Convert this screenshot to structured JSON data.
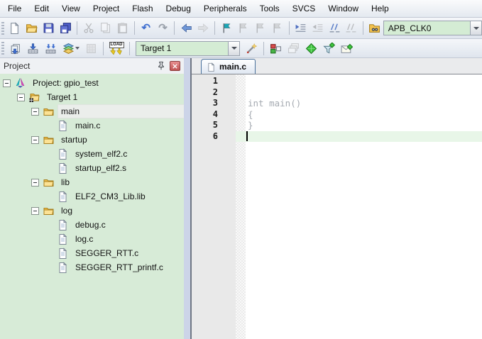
{
  "menu": {
    "items": [
      "File",
      "Edit",
      "View",
      "Project",
      "Flash",
      "Debug",
      "Peripherals",
      "Tools",
      "SVCS",
      "Window",
      "Help"
    ]
  },
  "toolbar_top": {
    "buttons": [
      "new-file",
      "open-file",
      "save",
      "save-all",
      "cut",
      "copy",
      "paste",
      "undo",
      "redo",
      "navigate-back",
      "navigate-forward",
      "toggle-bookmark",
      "previous-bookmark",
      "next-bookmark",
      "clear-bookmarks",
      "indent",
      "outdent",
      "comment",
      "uncomment",
      "find-in-files"
    ],
    "combo_value": "APB_CLK0"
  },
  "toolbar_build": {
    "buttons": [
      "translate",
      "build",
      "rebuild-all",
      "batch-build",
      "stop-build",
      "load-flash",
      "options-for-target",
      "manage-project-items",
      "multi-project-workspace",
      "manage-rte",
      "file-extensions-filter",
      "pack-installer"
    ],
    "load_label": "LOAD",
    "target_value": "Target 1"
  },
  "project_panel": {
    "title": "Project",
    "tree": {
      "items": [
        {
          "label": "Project: gpio_test",
          "level": 0,
          "icon": "uvision-project",
          "expanded": true
        },
        {
          "label": "Target 1",
          "level": 1,
          "icon": "target-folder",
          "expanded": true
        },
        {
          "label": "main",
          "level": 2,
          "icon": "folder",
          "expanded": true,
          "selected": true
        },
        {
          "label": "main.c",
          "level": 3,
          "icon": "file"
        },
        {
          "label": "startup",
          "level": 2,
          "icon": "folder",
          "expanded": true
        },
        {
          "label": "system_elf2.c",
          "level": 3,
          "icon": "file"
        },
        {
          "label": "startup_elf2.s",
          "level": 3,
          "icon": "file"
        },
        {
          "label": "lib",
          "level": 2,
          "icon": "folder",
          "expanded": true
        },
        {
          "label": "ELF2_CM3_Lib.lib",
          "level": 3,
          "icon": "file"
        },
        {
          "label": "log",
          "level": 2,
          "icon": "folder",
          "expanded": true
        },
        {
          "label": "debug.c",
          "level": 3,
          "icon": "file"
        },
        {
          "label": "log.c",
          "level": 3,
          "icon": "file"
        },
        {
          "label": "SEGGER_RTT.c",
          "level": 3,
          "icon": "file"
        },
        {
          "label": "SEGGER_RTT_printf.c",
          "level": 3,
          "icon": "file"
        }
      ]
    }
  },
  "editor": {
    "tab_label": "main.c",
    "line_numbers": [
      "1",
      "2",
      "3",
      "4",
      "5",
      "6"
    ],
    "code_lines": [
      "",
      "",
      "int main()",
      "{",
      "}",
      ""
    ],
    "current_line": 6
  },
  "colors": {
    "panel_green": "#d7ebd7",
    "combo_green": "#d4ecd4",
    "current_line_green": "#e8f6e8",
    "tab_border_blue": "#49719c",
    "code_text_gray": "#a5aab1"
  }
}
